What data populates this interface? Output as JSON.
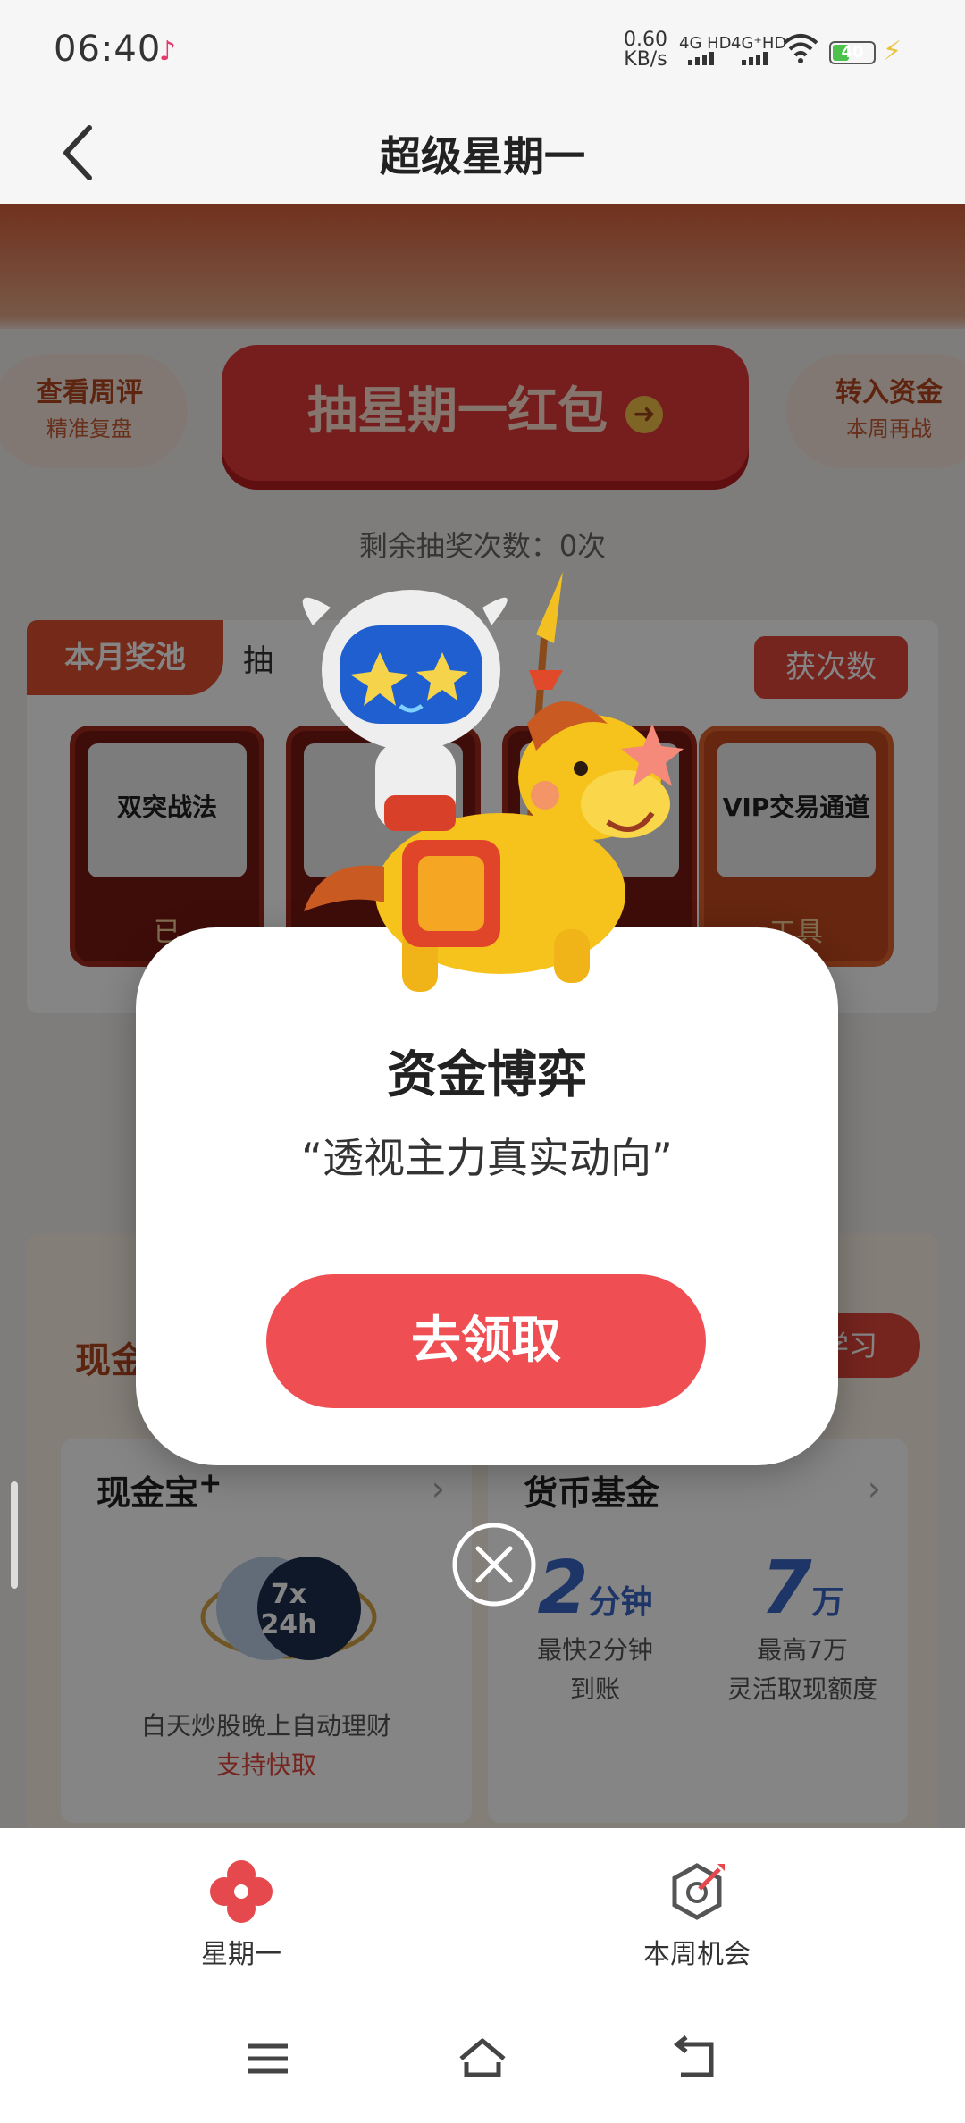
{
  "status_bar": {
    "time": "06:40",
    "net_speed_value": "0.60",
    "net_speed_unit": "KB/s",
    "sim1": "4G HD",
    "sim2": "4G⁺HD",
    "battery": "40",
    "battery_level": 0.4,
    "icons": [
      "tiktok-icon",
      "signal-icon",
      "wifi-icon",
      "battery-icon",
      "charging-icon"
    ]
  },
  "header": {
    "title": "超级星期一",
    "back_icon": "back-arrow-icon"
  },
  "content": {
    "left_pill": {
      "line1": "查看周评",
      "line2": "精准复盘"
    },
    "draw_button": "抽星期一红包",
    "right_pill": {
      "line1": "转入资金",
      "line2": "本周再战"
    },
    "remaining": "剩余抽奖次数：0次",
    "pool": {
      "tag": "本月奖池",
      "label": "抽",
      "get_button": "获次数",
      "prizes": [
        {
          "title": "双突战法",
          "caption": "已"
        },
        {
          "title": "",
          "caption": ""
        },
        {
          "title": "",
          "caption": ""
        },
        {
          "title": "VIP交易通道",
          "caption": "工具"
        }
      ]
    },
    "cash": {
      "heading": "现金宝",
      "learn_button": "学习",
      "card1": {
        "title": "现金宝",
        "title_sup": "+",
        "badge_top": "7x",
        "badge_bottom": "24h",
        "desc": "白天炒股晚上自动理财",
        "desc_highlight": "支持快取"
      },
      "card2": {
        "title": "货币基金",
        "stat1": {
          "num": "2",
          "unit": "分钟",
          "line1": "最快2分钟",
          "line2": "到账"
        },
        "stat2": {
          "num": "7",
          "unit": "万",
          "line1": "最高7万",
          "line2": "灵活取现额度"
        }
      }
    }
  },
  "modal": {
    "title": "资金博弈",
    "subtitle": "“透视主力真实动向”",
    "claim_button": "去领取",
    "close_icon": "close-circle-icon"
  },
  "bottom_nav": [
    {
      "label": "星期一",
      "icon": "flower-icon",
      "active": true
    },
    {
      "label": "本周机会",
      "icon": "target-icon",
      "active": false
    }
  ],
  "colors": {
    "accent": "#ef4e52",
    "brand_red": "#e0453a",
    "blue": "#3a67c7"
  }
}
